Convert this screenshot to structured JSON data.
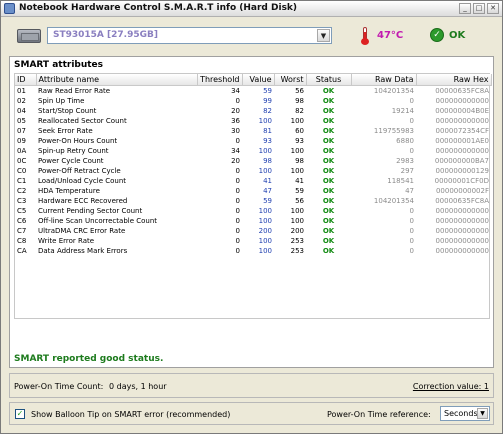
{
  "window": {
    "title": "Notebook Hardware Control  S.M.A.R.T  info (Hard Disk)",
    "controls": {
      "minimize": "_",
      "maximize": "□",
      "close": "✕"
    }
  },
  "drive": {
    "selected": "ST93015A  [27.95GB]",
    "temperature": "47°C",
    "status": "OK",
    "icons": {
      "drive": "hard-disk-icon",
      "temperature": "thermometer-icon",
      "status": "check-icon"
    }
  },
  "smart": {
    "title": "SMART attributes",
    "columns": [
      "ID",
      "Attribute name",
      "Threshold",
      "Value",
      "Worst",
      "Status",
      "Raw Data",
      "Raw Hex"
    ],
    "rows": [
      [
        "01",
        "Raw Read Error Rate",
        "34",
        "59",
        "56",
        "OK",
        "104201354",
        "00000635FC8A"
      ],
      [
        "02",
        "Spin Up Time",
        "0",
        "99",
        "98",
        "OK",
        "0",
        "000000000000"
      ],
      [
        "04",
        "Start/Stop Count",
        "20",
        "82",
        "82",
        "OK",
        "19214",
        "000000004B0E"
      ],
      [
        "05",
        "Reallocated Sector Count",
        "36",
        "100",
        "100",
        "OK",
        "0",
        "000000000000"
      ],
      [
        "07",
        "Seek Error Rate",
        "30",
        "81",
        "60",
        "OK",
        "119755983",
        "0000072354CF"
      ],
      [
        "09",
        "Power-On Hours Count",
        "0",
        "93",
        "93",
        "OK",
        "6880",
        "000000001AE0"
      ],
      [
        "0A",
        "Spin-up Retry Count",
        "34",
        "100",
        "100",
        "OK",
        "0",
        "000000000000"
      ],
      [
        "0C",
        "Power Cycle Count",
        "20",
        "98",
        "98",
        "OK",
        "2983",
        "000000000BA7"
      ],
      [
        "C0",
        "Power-Off Retract Cycle",
        "0",
        "100",
        "100",
        "OK",
        "297",
        "000000000129"
      ],
      [
        "C1",
        "Load/Unload Cycle Count",
        "0",
        "41",
        "41",
        "OK",
        "118541",
        "00000001CF0D"
      ],
      [
        "C2",
        "HDA Temperature",
        "0",
        "47",
        "59",
        "OK",
        "47",
        "00000000002F"
      ],
      [
        "C3",
        "Hardware ECC Recovered",
        "0",
        "59",
        "56",
        "OK",
        "104201354",
        "00000635FC8A"
      ],
      [
        "C5",
        "Current Pending Sector Count",
        "0",
        "100",
        "100",
        "OK",
        "0",
        "000000000000"
      ],
      [
        "C6",
        "Off-line Scan Uncorrectable Count",
        "0",
        "100",
        "100",
        "OK",
        "0",
        "000000000000"
      ],
      [
        "C7",
        "UltraDMA CRC Error Rate",
        "0",
        "200",
        "200",
        "OK",
        "0",
        "000000000000"
      ],
      [
        "C8",
        "Write Error Rate",
        "0",
        "100",
        "253",
        "OK",
        "0",
        "000000000000"
      ],
      [
        "CA",
        "Data Address Mark Errors",
        "0",
        "100",
        "253",
        "OK",
        "0",
        "000000000000"
      ]
    ],
    "status_message": "SMART reported good status."
  },
  "power_on": {
    "label": "Power-On Time Count:",
    "value": "0 days,  1 hour",
    "correction": "Correction value:  1"
  },
  "footer": {
    "balloon_checkbox_label": "Show Balloon Tip on SMART error (recommended)",
    "balloon_checked": true,
    "reference_label": "Power-On Time reference:",
    "reference_value": "Seconds"
  },
  "colors": {
    "value": "#1f3fb0",
    "ok": "#118a11",
    "raw": "#8c8c8c",
    "temperature": "#c21bb0"
  }
}
